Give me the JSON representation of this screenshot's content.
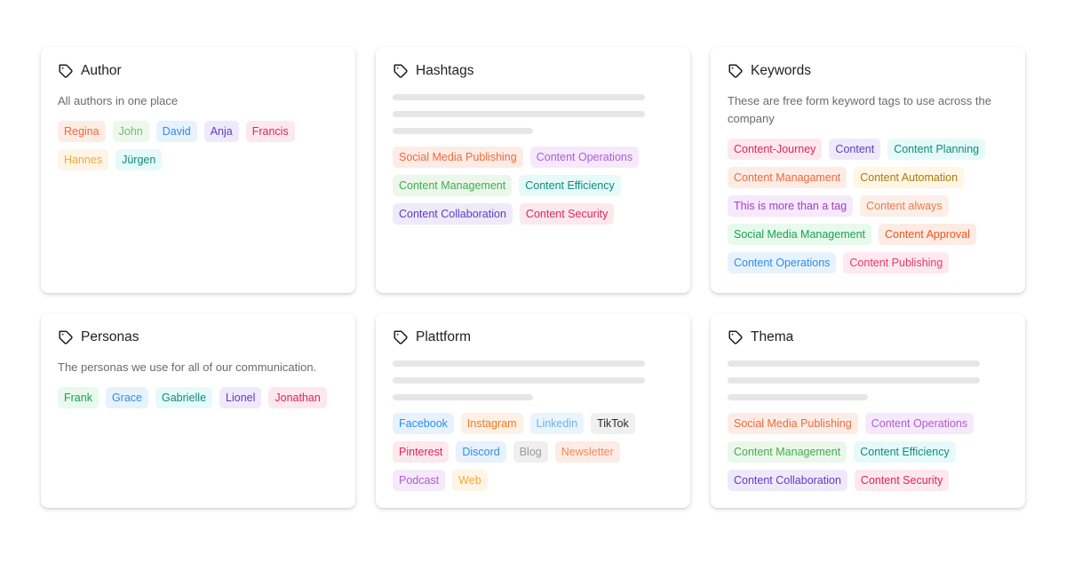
{
  "cards": [
    {
      "title": "Author",
      "icon": "tag-icon",
      "description": "All authors in one place",
      "skeleton": false,
      "tags": [
        {
          "label": "Regina",
          "color": "#f06a3a",
          "bg": "#fdece6"
        },
        {
          "label": "John",
          "color": "#6cc070",
          "bg": "#edf7ed"
        },
        {
          "label": "David",
          "color": "#2b8df0",
          "bg": "#e8f2fd"
        },
        {
          "label": "Anja",
          "color": "#5b3cc4",
          "bg": "#efeafb"
        },
        {
          "label": "Francis",
          "color": "#e0245e",
          "bg": "#fde8ee"
        },
        {
          "label": "Hannes",
          "color": "#f7a833",
          "bg": "#fff5e6"
        },
        {
          "label": "Jürgen",
          "color": "#0e8a80",
          "bg": "#e6fbf9"
        }
      ]
    },
    {
      "title": "Hashtags",
      "icon": "tag-icon",
      "description": "",
      "skeleton": true,
      "tags": [
        {
          "label": "Social Media Publishing",
          "color": "#f06a3a",
          "bg": "#fdece6"
        },
        {
          "label": "Content Operations",
          "color": "#b05cd6",
          "bg": "#f5e9fb"
        },
        {
          "label": "Content Management",
          "color": "#3fae4a",
          "bg": "#ecf7ec"
        },
        {
          "label": "Content Efficiency",
          "color": "#0e8a80",
          "bg": "#e6fbf9"
        },
        {
          "label": "Content Collaboration",
          "color": "#5b3cc4",
          "bg": "#efeafb"
        },
        {
          "label": "Content Security",
          "color": "#e0245e",
          "bg": "#fde8ee"
        }
      ]
    },
    {
      "title": "Keywords",
      "icon": "tag-icon",
      "description": "These are free form keyword tags to use across the company",
      "skeleton": false,
      "tags": [
        {
          "label": "Content-Journey",
          "color": "#e0245e",
          "bg": "#fde8ee"
        },
        {
          "label": "Content",
          "color": "#5b3cc4",
          "bg": "#efeafb"
        },
        {
          "label": "Content Planning",
          "color": "#0e8a80",
          "bg": "#e6fbf9"
        },
        {
          "label": "Content Managament",
          "color": "#f06a3a",
          "bg": "#fdece6"
        },
        {
          "label": "Content Automation",
          "color": "#a77a10",
          "bg": "#fff6e3"
        },
        {
          "label": "This is more than a tag",
          "color": "#a53cc8",
          "bg": "#f6e9fb"
        },
        {
          "label": "Content always",
          "color": "#f07a4a",
          "bg": "#fdeee7"
        },
        {
          "label": "Social Media Management",
          "color": "#16a34a",
          "bg": "#e8f9ee"
        },
        {
          "label": "Content Approval",
          "color": "#f0551e",
          "bg": "#fdebe4"
        },
        {
          "label": "Content Operations",
          "color": "#2b8df0",
          "bg": "#e8f2fd"
        },
        {
          "label": "Content Publishing",
          "color": "#e33b6a",
          "bg": "#fde9ef"
        }
      ]
    },
    {
      "title": "Personas",
      "icon": "tag-icon",
      "description": "The personas we use for all of our communication.",
      "skeleton": false,
      "tags": [
        {
          "label": "Frank",
          "color": "#16a34a",
          "bg": "#e8f9ee"
        },
        {
          "label": "Grace",
          "color": "#2b8df0",
          "bg": "#e8f2fd"
        },
        {
          "label": "Gabrielle",
          "color": "#0e8a80",
          "bg": "#e6fbf9"
        },
        {
          "label": "Lionel",
          "color": "#5b3cc4",
          "bg": "#efeafb"
        },
        {
          "label": "Jonathan",
          "color": "#e0245e",
          "bg": "#fde8ee"
        }
      ]
    },
    {
      "title": "Plattform",
      "icon": "tag-icon",
      "description": "",
      "skeleton": true,
      "tags": [
        {
          "label": "Facebook",
          "color": "#2b8df0",
          "bg": "#e8f2fd"
        },
        {
          "label": "Instagram",
          "color": "#f07a1e",
          "bg": "#fef0e4"
        },
        {
          "label": "Linkedin",
          "color": "#6ab4ee",
          "bg": "#eaf4fd"
        },
        {
          "label": "TikTok",
          "color": "#2a2a2a",
          "bg": "#f0f0f0"
        },
        {
          "label": "Pinterest",
          "color": "#e0245e",
          "bg": "#fde8ee"
        },
        {
          "label": "Discord",
          "color": "#2b8df0",
          "bg": "#e8f2fd"
        },
        {
          "label": "Blog",
          "color": "#9a9a9a",
          "bg": "#efefef"
        },
        {
          "label": "Newsletter",
          "color": "#f08a5a",
          "bg": "#fdece6"
        },
        {
          "label": "Podcast",
          "color": "#b05cd6",
          "bg": "#f5e9fb"
        },
        {
          "label": "Web",
          "color": "#f7a833",
          "bg": "#fff5e6"
        }
      ]
    },
    {
      "title": "Thema",
      "icon": "tag-icon",
      "description": "",
      "skeleton": true,
      "tags": [
        {
          "label": "Social Media Publishing",
          "color": "#f06a3a",
          "bg": "#fdece6"
        },
        {
          "label": "Content Operations",
          "color": "#b05cd6",
          "bg": "#f5e9fb"
        },
        {
          "label": "Content Management",
          "color": "#3fae4a",
          "bg": "#ecf7ec"
        },
        {
          "label": "Content Efficiency",
          "color": "#0e8a80",
          "bg": "#e6fbf9"
        },
        {
          "label": "Content Collaboration",
          "color": "#5b3cc4",
          "bg": "#efeafb"
        },
        {
          "label": "Content Security",
          "color": "#e0245e",
          "bg": "#fde8ee"
        }
      ]
    }
  ]
}
